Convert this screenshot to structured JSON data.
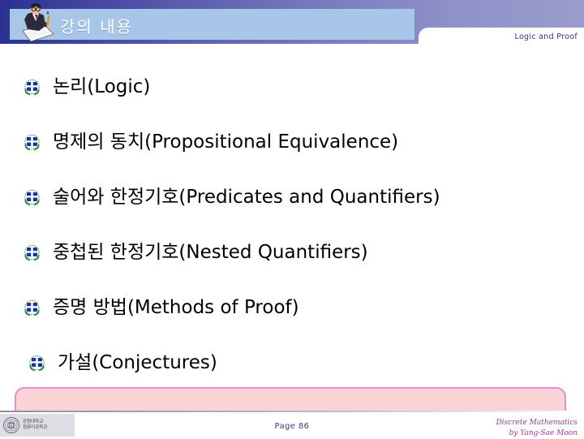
{
  "slide": {
    "header": {
      "title": "강의 내용",
      "subtitle": "Logic and Proof",
      "logo_icon": "presenter-writing-icon",
      "bar_color": "#a8c6e8",
      "gradient_from": "#2b2f8f",
      "gradient_to": "#9a9ccd"
    },
    "items": [
      {
        "label": "논리(Logic)",
        "bullet_icon": "university-emblem-bullet-icon",
        "highlighted": false
      },
      {
        "label": "명제의 동치(Propositional Equivalence)",
        "bullet_icon": "university-emblem-bullet-icon",
        "highlighted": false
      },
      {
        "label": "술어와 한정기호(Predicates and Quantifiers)",
        "bullet_icon": "university-emblem-bullet-icon",
        "highlighted": false
      },
      {
        "label": "중첩된 한정기호(Nested Quantifiers)",
        "bullet_icon": "university-emblem-bullet-icon",
        "highlighted": false
      },
      {
        "label": "증명 방법(Methods of Proof)",
        "bullet_icon": "university-emblem-bullet-icon",
        "highlighted": false
      },
      {
        "label": "가설(Conjectures)",
        "bullet_icon": "university-emblem-bullet-icon",
        "highlighted": true
      }
    ],
    "highlight": {
      "fill_color": "#fbd3d6",
      "border_color": "#e08fd8"
    },
    "footer": {
      "seal_icon": "university-seal-icon",
      "org_line1": "강원대학교",
      "org_line2": "컴퓨터과학과",
      "page": "Page 86",
      "credit_line1": "Discrete Mathematics",
      "credit_line2": "by Yang-Sae Moon",
      "credit_color": "#8f3f9f",
      "page_color": "#3c3c84"
    }
  }
}
